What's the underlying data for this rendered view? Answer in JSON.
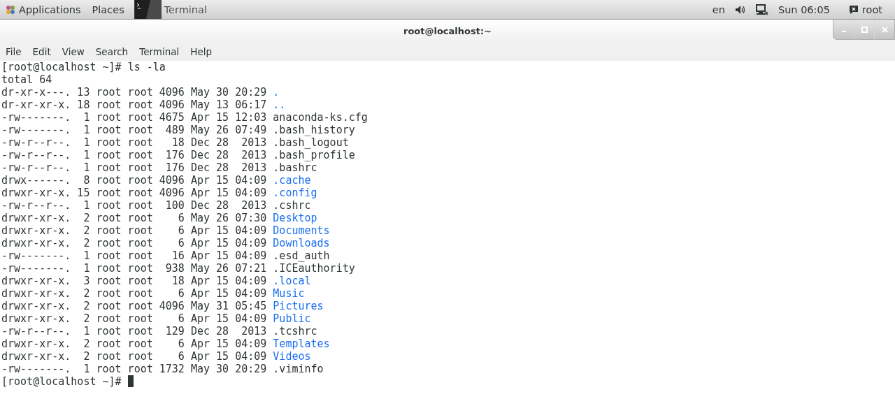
{
  "top_panel": {
    "menus": [
      "Applications",
      "Places"
    ],
    "task": {
      "label": "Terminal"
    },
    "status": {
      "language": "en",
      "clock": "Sun 06:05",
      "user": "root"
    }
  },
  "window": {
    "title": "root@localhost:~"
  },
  "menu_bar": [
    "File",
    "Edit",
    "View",
    "Search",
    "Terminal",
    "Help"
  ],
  "terminal": {
    "command_line": {
      "prompt": "[root@localhost ~]#",
      "command": "ls -la"
    },
    "total": "total 64",
    "entries": [
      {
        "details": "dr-xr-x---. 13 root root 4096 May 30 20:29",
        "name": ".",
        "kind": "dir"
      },
      {
        "details": "dr-xr-xr-x. 18 root root 4096 May 13 06:17",
        "name": "..",
        "kind": "dir"
      },
      {
        "details": "-rw-------.  1 root root 4675 Apr 15 12:03",
        "name": "anaconda-ks.cfg",
        "kind": "file"
      },
      {
        "details": "-rw-------.  1 root root  489 May 26 07:49",
        "name": ".bash_history",
        "kind": "file"
      },
      {
        "details": "-rw-r--r--.  1 root root   18 Dec 28  2013",
        "name": ".bash_logout",
        "kind": "file"
      },
      {
        "details": "-rw-r--r--.  1 root root  176 Dec 28  2013",
        "name": ".bash_profile",
        "kind": "file"
      },
      {
        "details": "-rw-r--r--.  1 root root  176 Dec 28  2013",
        "name": ".bashrc",
        "kind": "file"
      },
      {
        "details": "drwx------.  8 root root 4096 Apr 15 04:09",
        "name": ".cache",
        "kind": "dir"
      },
      {
        "details": "drwxr-xr-x. 15 root root 4096 Apr 15 04:09",
        "name": ".config",
        "kind": "dir"
      },
      {
        "details": "-rw-r--r--.  1 root root  100 Dec 28  2013",
        "name": ".cshrc",
        "kind": "file"
      },
      {
        "details": "drwxr-xr-x.  2 root root    6 May 26 07:30",
        "name": "Desktop",
        "kind": "dir"
      },
      {
        "details": "drwxr-xr-x.  2 root root    6 Apr 15 04:09",
        "name": "Documents",
        "kind": "dir"
      },
      {
        "details": "drwxr-xr-x.  2 root root    6 Apr 15 04:09",
        "name": "Downloads",
        "kind": "dir"
      },
      {
        "details": "-rw-------.  1 root root   16 Apr 15 04:09",
        "name": ".esd_auth",
        "kind": "file"
      },
      {
        "details": "-rw-------.  1 root root  938 May 26 07:21",
        "name": ".ICEauthority",
        "kind": "file"
      },
      {
        "details": "drwxr-xr-x.  3 root root   18 Apr 15 04:09",
        "name": ".local",
        "kind": "dir"
      },
      {
        "details": "drwxr-xr-x.  2 root root    6 Apr 15 04:09",
        "name": "Music",
        "kind": "dir"
      },
      {
        "details": "drwxr-xr-x.  2 root root 4096 May 31 05:45",
        "name": "Pictures",
        "kind": "dir"
      },
      {
        "details": "drwxr-xr-x.  2 root root    6 Apr 15 04:09",
        "name": "Public",
        "kind": "dir"
      },
      {
        "details": "-rw-r--r--.  1 root root  129 Dec 28  2013",
        "name": ".tcshrc",
        "kind": "file"
      },
      {
        "details": "drwxr-xr-x.  2 root root    6 Apr 15 04:09",
        "name": "Templates",
        "kind": "dir"
      },
      {
        "details": "drwxr-xr-x.  2 root root    6 Apr 15 04:09",
        "name": "Videos",
        "kind": "dir"
      },
      {
        "details": "-rw-------.  1 root root 1732 May 30 20:29",
        "name": ".viminfo",
        "kind": "file"
      }
    ],
    "final_prompt": "[root@localhost ~]#"
  }
}
